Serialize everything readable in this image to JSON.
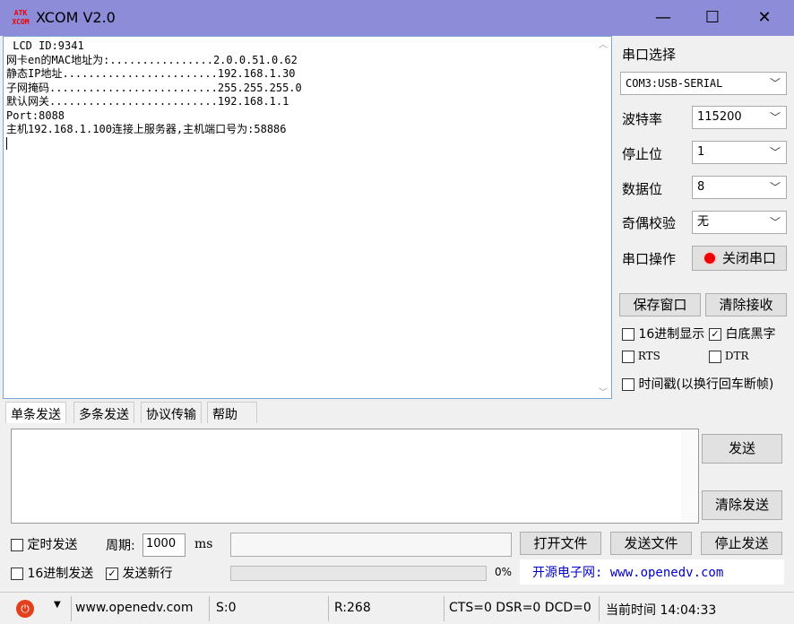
{
  "window": {
    "title": "XCOM V2.0",
    "logo": "ATK XCOM"
  },
  "receive": {
    "lines": [
      " LCD ID:9341",
      "网卡en的MAC地址为:................2.0.0.51.0.62",
      "静态IP地址........................192.168.1.30",
      "子网掩码..........................255.255.255.0",
      "默认网关..........................192.168.1.1",
      "Port:8088",
      "主机192.168.1.100连接上服务器,主机端口号为:58886"
    ]
  },
  "settings": {
    "port_select_label": "串口选择",
    "port": "COM3:USB-SERIAL",
    "baud_label": "波特率",
    "baud": "115200",
    "stop_label": "停止位",
    "stop": "1",
    "data_label": "数据位",
    "data": "8",
    "parity_label": "奇偶校验",
    "parity": "无",
    "op_label": "串口操作",
    "close_port": "关闭串口",
    "save_window": "保存窗口",
    "clear_receive": "清除接收",
    "hex_display": "16进制显示",
    "white_black": "白底黑字",
    "rts": "RTS",
    "dtr": "DTR",
    "timestamp": "时间戳(以换行回车断帧)"
  },
  "tabs": [
    "单条发送",
    "多条发送",
    "协议传输",
    "帮助"
  ],
  "send": {
    "send": "发送",
    "clear_send": "清除发送",
    "timed_send": "定时发送",
    "period_label": "周期:",
    "period": "1000",
    "ms": "ms",
    "open_file": "打开文件",
    "send_file": "发送文件",
    "stop_send": "停止发送",
    "hex_send": "16进制发送",
    "send_newline": "发送新行",
    "progress": "0%",
    "banner": "开源电子网: www.openedv.com"
  },
  "status": {
    "url": "www.openedv.com",
    "sent": "S:0",
    "received": "R:268",
    "signals": "CTS=0 DSR=0 DCD=0",
    "time": "当前时间 14:04:33"
  },
  "colors": {
    "titlebar": "#8d8cd8",
    "banner_text": "#0000cc",
    "port_indicator": "#e00000"
  }
}
